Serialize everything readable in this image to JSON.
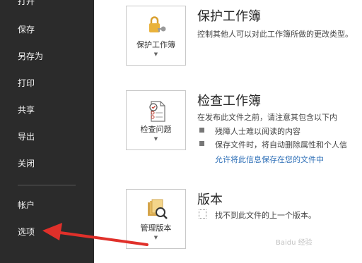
{
  "sidebar": {
    "items": [
      {
        "label": "打开"
      },
      {
        "label": "保存"
      },
      {
        "label": "另存为"
      },
      {
        "label": "打印"
      },
      {
        "label": "共享"
      },
      {
        "label": "导出"
      },
      {
        "label": "关闭"
      },
      {
        "label": "帐户"
      },
      {
        "label": "选项"
      }
    ]
  },
  "protect": {
    "button_label": "保护工作簿",
    "title": "保护工作簿",
    "description": "控制其他人可以对此工作簿所做的更改类型。"
  },
  "inspect": {
    "button_label": "检查问题",
    "title": "检查工作簿",
    "description": "在发布此文件之前，请注意其包含以下内",
    "bullets": [
      "残障人士难以阅读的内容",
      "保存文件时，将自动删除属性和个人信"
    ],
    "link": "允许将此信息保存在您的文件中"
  },
  "versions": {
    "button_label": "管理版本",
    "title": "版本",
    "description": "找不到此文件的上一个版本。"
  },
  "watermark": "Baidu 经验"
}
